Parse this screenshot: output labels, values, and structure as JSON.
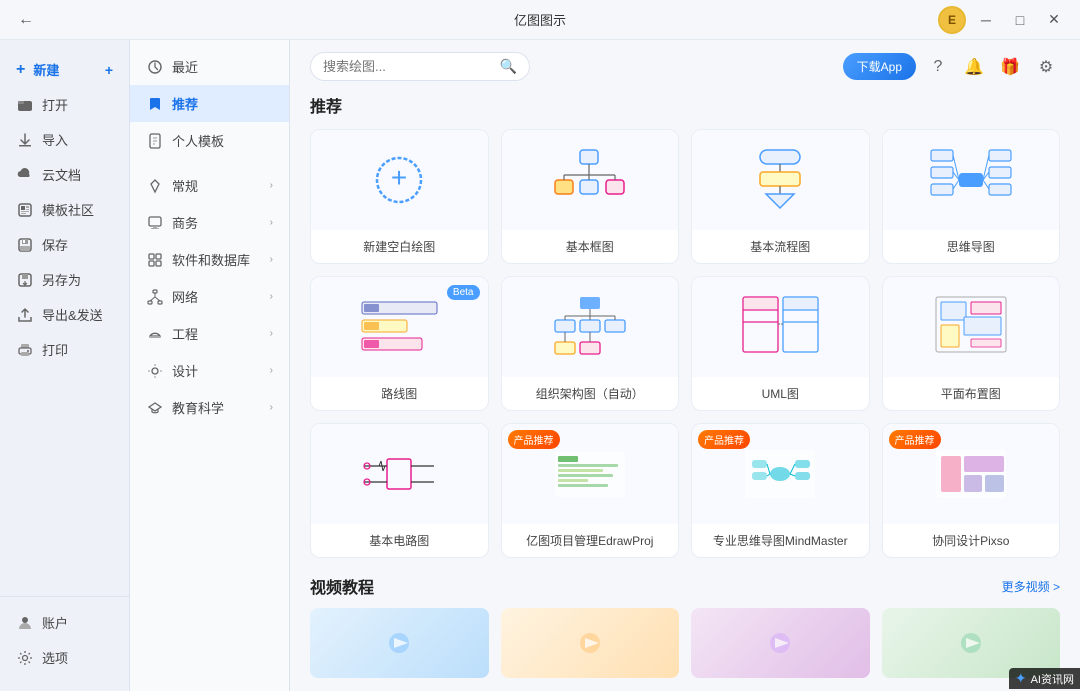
{
  "app": {
    "title": "亿图图示"
  },
  "titlebar": {
    "minimize": "─",
    "maximize": "□",
    "close": "✕",
    "avatar_letter": "E",
    "download_label": "下载App"
  },
  "left_sidebar": {
    "new_label": "新建",
    "items": [
      {
        "id": "open",
        "label": "打开",
        "icon": "folder"
      },
      {
        "id": "import",
        "label": "导入",
        "icon": "import"
      },
      {
        "id": "cloud",
        "label": "云文档",
        "icon": "cloud"
      },
      {
        "id": "template",
        "label": "模板社区",
        "icon": "template"
      },
      {
        "id": "save",
        "label": "保存",
        "icon": "save"
      },
      {
        "id": "saveas",
        "label": "另存为",
        "icon": "saveas"
      },
      {
        "id": "export",
        "label": "导出&发送",
        "icon": "export"
      },
      {
        "id": "print",
        "label": "打印",
        "icon": "print"
      }
    ],
    "bottom_items": [
      {
        "id": "account",
        "label": "账户",
        "icon": "account"
      },
      {
        "id": "settings",
        "label": "选项",
        "icon": "settings"
      }
    ]
  },
  "mid_nav": {
    "items": [
      {
        "id": "recent",
        "label": "最近",
        "icon": "clock",
        "has_arrow": false,
        "active": false
      },
      {
        "id": "recommend",
        "label": "推荐",
        "icon": "bookmark",
        "has_arrow": false,
        "active": true
      },
      {
        "id": "personal",
        "label": "个人模板",
        "icon": "file",
        "has_arrow": false,
        "active": false
      },
      {
        "id": "general",
        "label": "常规",
        "icon": "diamond",
        "has_arrow": true,
        "active": false
      },
      {
        "id": "business",
        "label": "商务",
        "icon": "monitor",
        "has_arrow": true,
        "active": false
      },
      {
        "id": "software",
        "label": "软件和数据库",
        "icon": "grid",
        "has_arrow": true,
        "active": false
      },
      {
        "id": "network",
        "label": "网络",
        "icon": "grid2",
        "has_arrow": true,
        "active": false
      },
      {
        "id": "engineering",
        "label": "工程",
        "icon": "helmet",
        "has_arrow": true,
        "active": false
      },
      {
        "id": "design",
        "label": "设计",
        "icon": "design",
        "has_arrow": true,
        "active": false
      },
      {
        "id": "education",
        "label": "教育科学",
        "icon": "edu",
        "has_arrow": true,
        "active": false
      }
    ]
  },
  "search": {
    "placeholder": "搜索绘图...",
    "value": ""
  },
  "main": {
    "recommend_title": "推荐",
    "video_title": "视频教程",
    "more_videos": "更多视频 >",
    "templates": [
      {
        "id": "new-blank",
        "label": "新建空白绘图",
        "type": "new",
        "badge": null
      },
      {
        "id": "basic-frame",
        "label": "基本框图",
        "type": "frame",
        "badge": null
      },
      {
        "id": "basic-flow",
        "label": "基本流程图",
        "type": "flow",
        "badge": null
      },
      {
        "id": "mindmap",
        "label": "思维导图",
        "type": "mind",
        "badge": null
      },
      {
        "id": "route",
        "label": "路线图",
        "type": "route",
        "badge": "Beta"
      },
      {
        "id": "org-auto",
        "label": "组织架构图（自动）",
        "type": "org",
        "badge": null
      },
      {
        "id": "uml",
        "label": "UML图",
        "type": "uml",
        "badge": null
      },
      {
        "id": "layout",
        "label": "平面布置图",
        "type": "layout",
        "badge": null
      },
      {
        "id": "circuit",
        "label": "基本电路图",
        "type": "circuit",
        "badge": null
      },
      {
        "id": "edrawproj",
        "label": "亿图项目管理EdrawProj",
        "type": "product",
        "badge": "产品推荐"
      },
      {
        "id": "mindmaster",
        "label": "专业思维导图MindMaster",
        "type": "product2",
        "badge": "产品推荐"
      },
      {
        "id": "pixso",
        "label": "协同设计Pixso",
        "type": "product3",
        "badge": "产品推荐"
      }
    ],
    "videos": [
      {
        "id": "v1",
        "bg": "video1"
      },
      {
        "id": "v2",
        "bg": "video2"
      },
      {
        "id": "v3",
        "bg": "video3"
      },
      {
        "id": "v4",
        "bg": "video4"
      }
    ]
  }
}
